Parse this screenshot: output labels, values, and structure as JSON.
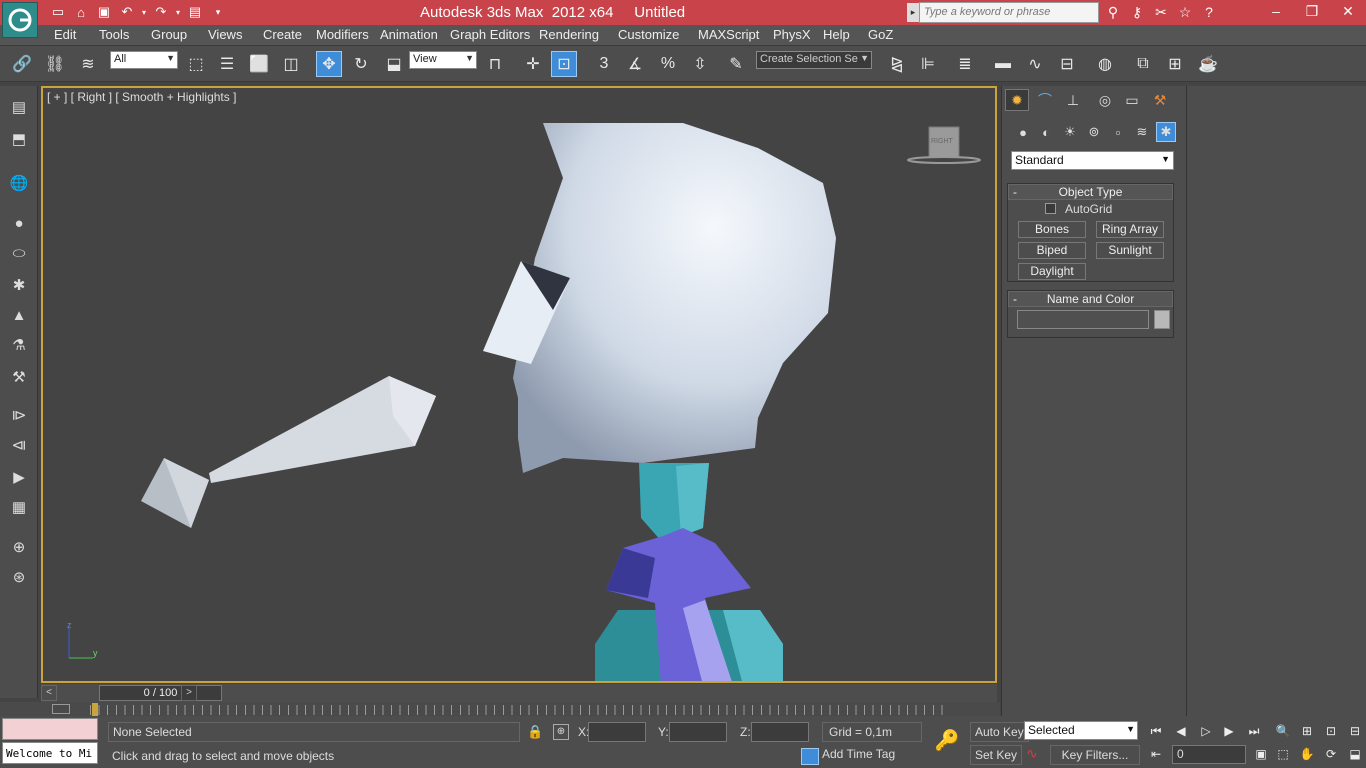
{
  "window": {
    "title": "Autodesk 3ds Max  2012 x64     Untitled",
    "search_placeholder": "Type a keyword or phrase"
  },
  "menu": [
    "Edit",
    "Tools",
    "Group",
    "Views",
    "Create",
    "Modifiers",
    "Animation",
    "Graph Editors",
    "Rendering",
    "Customize",
    "MAXScript",
    "PhysX",
    "Help",
    "GoZ"
  ],
  "toolbar": {
    "selection_filter": "All",
    "reference_coord": "View",
    "snap_angle": "3",
    "named_selection": "Create Selection Se",
    "active_tool": "select-and-move"
  },
  "viewport": {
    "label": "[ + ] [ Right ] [ Smooth + Highlights ]",
    "viewcube_label": "RIGHT",
    "axis_z": "z",
    "axis_y": "y"
  },
  "timeslider": {
    "frame": "0 / 100",
    "prev": "<",
    "next": ">"
  },
  "status": {
    "maxscript_output": "Welcome to Mi",
    "selection_info": "None Selected",
    "prompt": "Click and drag to select and move objects",
    "x_label": "X:",
    "y_label": "Y:",
    "z_label": "Z:",
    "grid": "Grid = 0,1m",
    "add_time_tag": "Add Time Tag",
    "auto_key": "Auto Key",
    "set_key": "Set Key",
    "key_filters": "Key Filters...",
    "key_mode": "Selected",
    "current_frame": "0"
  },
  "command_panel": {
    "category": "Standard",
    "object_type_title": "Object Type",
    "autogrid": "AutoGrid",
    "buttons": [
      "Bones",
      "Ring Array",
      "Biped",
      "Sunlight",
      "Daylight"
    ],
    "name_color_title": "Name and Color",
    "collapse_symbol": "-"
  },
  "colors": {
    "title_bar": "#c8434a",
    "viewport_border": "#c9a43c",
    "active_button": "#3f8dd8",
    "head": "#c7d3e2",
    "neck": "#3aa6b3",
    "collar": "#6a62d6"
  }
}
